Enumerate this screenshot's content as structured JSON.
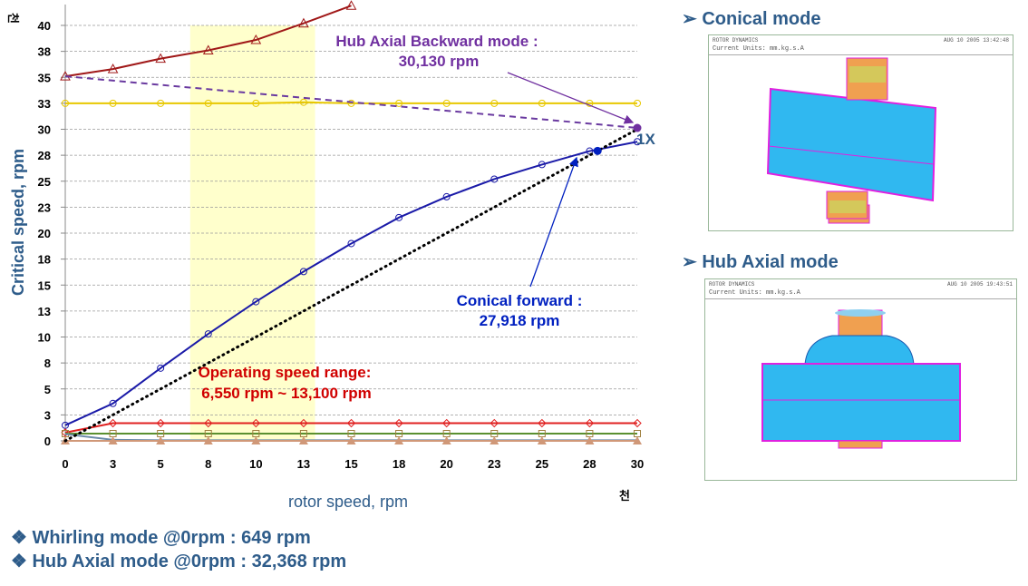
{
  "chart_data": {
    "type": "line",
    "xlabel": "rotor speed, rpm",
    "ylabel": "Critical speed, rpm",
    "x_unit_label": "천",
    "y_unit_label": "천",
    "xlim": [
      0,
      30
    ],
    "ylim": [
      0,
      40
    ],
    "x_ticks": [
      0,
      2.5,
      5,
      7.5,
      10,
      12.5,
      15,
      17.5,
      20,
      22.5,
      25,
      27.5,
      30
    ],
    "x_tick_labels": [
      "0",
      "3",
      "5",
      "8",
      "10",
      "13",
      "15",
      "18",
      "20",
      "23",
      "25",
      "28",
      "30"
    ],
    "y_ticks": [
      0,
      2.5,
      5,
      7.5,
      10,
      12.5,
      15,
      17.5,
      20,
      22.5,
      25,
      27.5,
      30,
      32.5,
      35,
      37.5,
      40
    ],
    "y_tick_labels": [
      "0",
      "3",
      "5",
      "8",
      "10",
      "13",
      "15",
      "18",
      "20",
      "23",
      "25",
      "28",
      "30",
      "33",
      "35",
      "38",
      "40"
    ],
    "grid": "horizontal dashed",
    "operating_range": {
      "from": 6.55,
      "to": 13.1,
      "color": "#ffffcc"
    },
    "series": [
      {
        "color": "#a01818",
        "marker": "triangle-open",
        "x": [
          0,
          2.5,
          5,
          7.5,
          10,
          12.5,
          15
        ],
        "y": [
          35.1,
          35.8,
          36.8,
          37.6,
          38.6,
          40.2,
          41.9
        ]
      },
      {
        "color": "#e8c800",
        "marker": "circle-open",
        "x": [
          0,
          2.5,
          5,
          7.5,
          10,
          12.5,
          15,
          17.5,
          20,
          22.5,
          25,
          27.5,
          30
        ],
        "y": [
          32.5,
          32.5,
          32.5,
          32.5,
          32.5,
          32.6,
          32.5,
          32.5,
          32.5,
          32.5,
          32.5,
          32.5,
          32.5
        ]
      },
      {
        "color": "#1a1aa8",
        "marker": "circle-open",
        "x": [
          0,
          2.5,
          5,
          7.5,
          10,
          12.5,
          15,
          17.5,
          20,
          22.5,
          25,
          27.5,
          30
        ],
        "y": [
          1.5,
          3.6,
          7.0,
          10.3,
          13.4,
          16.3,
          19.0,
          21.5,
          23.5,
          25.2,
          26.6,
          27.9,
          28.8
        ]
      },
      {
        "color": "#e02020",
        "marker": "diamond-open",
        "x": [
          0,
          2.5,
          5,
          7.5,
          10,
          12.5,
          15,
          17.5,
          20,
          22.5,
          25,
          27.5,
          30
        ],
        "y": [
          0.8,
          1.7,
          1.7,
          1.7,
          1.7,
          1.7,
          1.7,
          1.7,
          1.7,
          1.7,
          1.7,
          1.7,
          1.7
        ]
      },
      {
        "color": "#5a9030",
        "marker": "square-open",
        "x": [
          0,
          2.5,
          5,
          7.5,
          10,
          12.5,
          15,
          17.5,
          20,
          22.5,
          25,
          27.5,
          30
        ],
        "y": [
          0.7,
          0.7,
          0.7,
          0.7,
          0.7,
          0.7,
          0.7,
          0.7,
          0.7,
          0.7,
          0.7,
          0.7,
          0.7
        ]
      },
      {
        "color": "#6a8aa8",
        "marker": "none",
        "x": [
          0,
          2.5,
          5,
          7.5,
          10,
          12.5,
          15,
          17.5,
          20,
          22.5,
          25,
          27.5,
          30
        ],
        "y": [
          0.65,
          0.1,
          0.05,
          0.05,
          0.05,
          0.05,
          0.05,
          0.05,
          0.05,
          0.05,
          0.05,
          0.05,
          0.05
        ]
      },
      {
        "color": "#d09878",
        "marker": "triangle-filled",
        "x": [
          0,
          2.5,
          5,
          7.5,
          10,
          12.5,
          15,
          17.5,
          20,
          22.5,
          25,
          27.5,
          30
        ],
        "y": [
          0,
          0,
          0,
          0,
          0,
          0,
          0,
          0,
          0,
          0,
          0,
          0,
          0
        ]
      },
      {
        "color": "#6a3aa0",
        "marker": "none",
        "dash": "dashed",
        "x": [
          0,
          30
        ],
        "y": [
          35.1,
          30.13
        ]
      },
      {
        "color": "#000000",
        "marker": "none",
        "dash": "dotted",
        "name": "1X",
        "x": [
          0,
          30
        ],
        "y": [
          0,
          30
        ]
      }
    ],
    "highlight_points": [
      {
        "x": 30,
        "y": 30.13,
        "color": "#7030a0"
      },
      {
        "x": 27.918,
        "y": 27.918,
        "color": "#0020c0"
      }
    ],
    "annotations": {
      "hub_backward_title": "Hub Axial Backward mode :",
      "hub_backward_value": "30,130 rpm",
      "conical_forward_title": "Conical forward :",
      "conical_forward_value": "27,918 rpm",
      "operating_title": "Operating speed range:",
      "operating_value": "6,550 rpm ~ 13,100 rpm",
      "one_x": "1X"
    }
  },
  "colors": {
    "heading": "#2e5c8a",
    "purple": "#7030a0",
    "blue": "#0020c0",
    "red": "#d00000"
  },
  "panels": {
    "conical": {
      "heading": "➢ Conical mode",
      "title": "ROTOR DYNAMICS",
      "date": "AUG 10 2005 13:42:48",
      "units": "Current Units: mm.kg.s.A"
    },
    "hub_axial": {
      "heading": "➢ Hub Axial mode",
      "title": "ROTOR DYNAMICS",
      "date": "AUG 10 2005 19:43:51",
      "units": "Current Units: mm.kg.s.A"
    }
  },
  "notes": [
    "❖ Whirling mode @0rpm : 649 rpm",
    "❖  Hub Axial mode @0rpm : 32,368 rpm"
  ]
}
